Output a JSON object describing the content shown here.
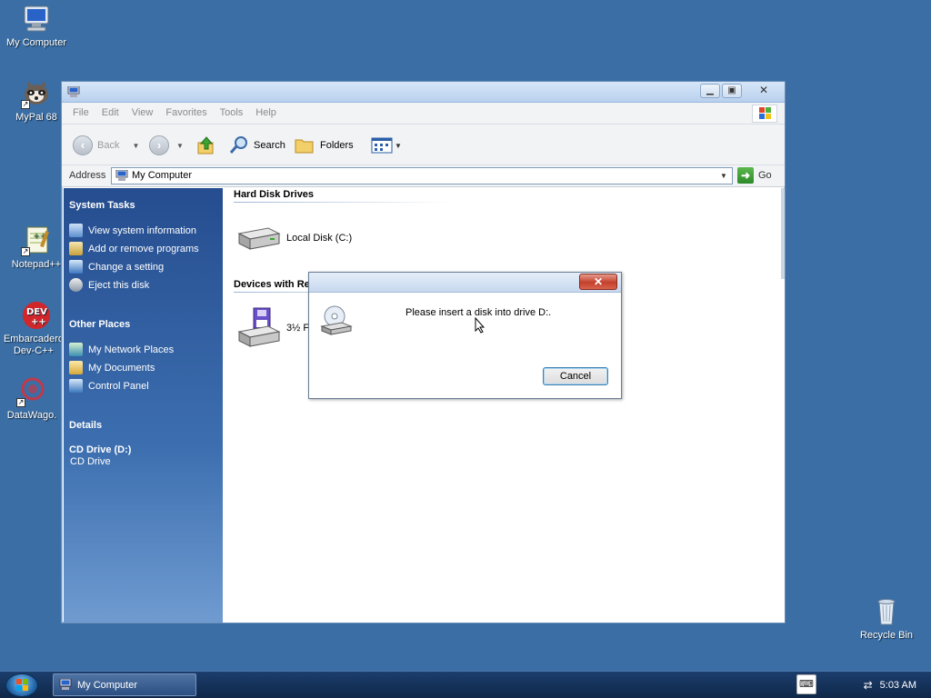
{
  "desktop": {
    "icons": [
      {
        "label": "My Computer"
      },
      {
        "label": "MyPal 68"
      },
      {
        "label": "Notepad++"
      },
      {
        "label": "Embarcadero Dev-C++"
      },
      {
        "label": "DataWago."
      },
      {
        "label": "Recycle Bin"
      }
    ]
  },
  "window": {
    "menu": [
      "File",
      "Edit",
      "View",
      "Favorites",
      "Tools",
      "Help"
    ],
    "toolbar": {
      "back": "Back",
      "search": "Search",
      "folders": "Folders"
    },
    "address": {
      "label": "Address",
      "value": "My Computer",
      "go": "Go"
    },
    "sidebar": {
      "system_tasks": {
        "heading": "System Tasks",
        "items": [
          "View system information",
          "Add or remove programs",
          "Change a setting",
          "Eject this disk"
        ]
      },
      "other_places": {
        "heading": "Other Places",
        "items": [
          "My Network Places",
          "My Documents",
          "Control Panel"
        ]
      },
      "details": {
        "heading": "Details",
        "name": "CD Drive (D:)",
        "type": "CD Drive"
      }
    },
    "content": {
      "groups": [
        {
          "heading": "Hard Disk Drives",
          "items": [
            "Local Disk (C:)"
          ]
        },
        {
          "heading": "Devices with Re",
          "items": [
            "3½ F"
          ]
        }
      ]
    }
  },
  "dialog": {
    "message": "Please insert a disk into drive D:.",
    "cancel": "Cancel"
  },
  "taskbar": {
    "task": "My Computer",
    "clock": "5:03 AM"
  },
  "colors": {
    "desktop": "#3a6ea5",
    "sidebar": "#254d8f",
    "dialog_close": "#c3402c"
  }
}
